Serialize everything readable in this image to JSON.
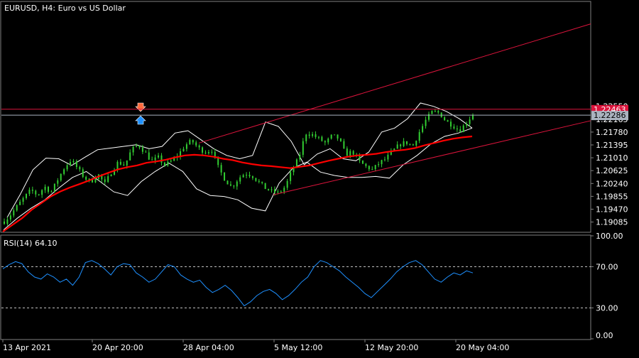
{
  "header": {
    "title": "EURUSD, H4:  Euro vs US Dollar"
  },
  "indicator": {
    "label": "RSI(14) 64.10"
  },
  "price_axis": {
    "ticks": [
      "1.22550",
      "1.22165",
      "1.21780",
      "1.21395",
      "1.21010",
      "1.20625",
      "1.20240",
      "1.19855",
      "1.19470",
      "1.19085"
    ],
    "bid_label": "1.22463",
    "ask_label": "1.22286",
    "bid_color": "#dc143c",
    "ask_color": "#aab3bf"
  },
  "rsi_axis": {
    "ticks": [
      "100.00",
      "70.00",
      "30.00",
      "0.00"
    ]
  },
  "time_axis": {
    "ticks": [
      "13 Apr 2021",
      "20 Apr 20:00",
      "28 Apr 04:00",
      "5 May 12:00",
      "12 May 20:00",
      "20 May 04:00"
    ]
  },
  "colors": {
    "background": "#000000",
    "bull": "#32cd32",
    "grid": "#808080",
    "ma": "#ff0000",
    "bands": "#ffffff",
    "trendline": "#dc143c",
    "rsi": "#1e90ff",
    "sell_arrow": "#ff6a3d",
    "buy_arrow": "#1e90ff"
  },
  "chart_data": [
    {
      "type": "candlestick",
      "symbol": "EURUSD",
      "timeframe": "H4",
      "ylim": [
        1.188,
        1.2565
      ],
      "series": [
        {
          "name": "price",
          "values": [
            1.191,
            1.1932,
            1.1958,
            1.1982,
            1.2005,
            1.1988,
            1.2015,
            1.1998,
            1.2036,
            1.2072,
            1.2095,
            1.2068,
            1.204,
            1.203,
            1.2052,
            1.2022,
            1.2058,
            1.2088,
            1.2078,
            1.2125,
            1.214,
            1.2118,
            1.209,
            1.2102,
            1.2078,
            1.2092,
            1.211,
            1.2138,
            1.2152,
            1.213,
            1.2118,
            1.2125,
            1.207,
            1.2035,
            1.2012,
            1.204,
            1.2055,
            1.2048,
            1.2028,
            1.201,
            1.2,
            1.1995,
            1.2015,
            1.2065,
            1.21,
            1.2175,
            1.217,
            1.2158,
            1.2145,
            1.2168,
            1.2158,
            1.211,
            1.212,
            1.209,
            1.2075,
            1.2065,
            1.2085,
            1.2098,
            1.212,
            1.214,
            1.2148,
            1.2135,
            1.2178,
            1.2215,
            1.224,
            1.2235,
            1.221,
            1.2198,
            1.2182,
            1.2205,
            1.2232
          ]
        },
        {
          "name": "moving average",
          "values": [
            1.188,
            1.19,
            1.192,
            1.1945,
            1.1965,
            1.1985,
            1.2,
            1.2012,
            1.2022,
            1.2033,
            1.2045,
            1.2056,
            1.2066,
            1.2073,
            1.2078,
            1.2086,
            1.209,
            1.2095,
            1.2102,
            1.2108,
            1.211,
            1.2108,
            1.2104,
            1.2098,
            1.2094,
            1.2087,
            1.2082,
            1.2078,
            1.2076,
            1.2073,
            1.207,
            1.2074,
            1.2078,
            1.2085,
            1.2092,
            1.2098,
            1.2104,
            1.2108,
            1.211,
            1.2113,
            1.2118,
            1.2122,
            1.2125,
            1.213,
            1.2138,
            1.2145,
            1.2152,
            1.2158,
            1.2162,
            1.2165
          ]
        },
        {
          "name": "upper band",
          "values": [
            1.1922,
            1.199,
            1.2065,
            1.21,
            1.2098,
            1.2078,
            1.2102,
            1.2125,
            1.213,
            1.2135,
            1.214,
            1.2128,
            1.2135,
            1.2175,
            1.2182,
            1.2155,
            1.2128,
            1.2108,
            1.2098,
            1.2108,
            1.2208,
            1.2195,
            1.215,
            1.208,
            1.2112,
            1.2128,
            1.2098,
            1.2092,
            1.2118,
            1.2178,
            1.219,
            1.2218,
            1.2265,
            1.2255,
            1.224,
            1.2218,
            1.219
          ]
        },
        {
          "name": "lower band",
          "values": [
            1.1885,
            1.192,
            1.195,
            1.1975,
            1.201,
            1.2042,
            1.206,
            1.203,
            1.1999,
            1.1988,
            1.203,
            1.206,
            1.2085,
            1.206,
            1.2008,
            1.1988,
            1.1985,
            1.1975,
            1.195,
            1.1942,
            1.2025,
            1.207,
            1.2088,
            1.2058,
            1.2048,
            1.2042,
            1.2042,
            1.2045,
            1.204,
            1.208,
            1.2108,
            1.2142,
            1.2165,
            1.2175,
            1.219
          ]
        }
      ]
    },
    {
      "type": "line",
      "name": "RSI(14)",
      "ylim": [
        0,
        100
      ],
      "levels": [
        70,
        30
      ],
      "values": [
        68,
        72,
        75,
        73,
        65,
        60,
        58,
        63,
        60,
        55,
        58,
        52,
        60,
        74,
        76,
        73,
        68,
        62,
        70,
        73,
        72,
        64,
        60,
        55,
        58,
        65,
        72,
        70,
        62,
        58,
        55,
        57,
        50,
        45,
        48,
        52,
        47,
        40,
        32,
        36,
        42,
        46,
        48,
        44,
        38,
        42,
        48,
        55,
        60,
        70,
        76,
        74,
        70,
        66,
        60,
        55,
        50,
        44,
        40,
        46,
        52,
        58,
        65,
        70,
        74,
        76,
        72,
        65,
        58,
        55,
        60,
        64,
        62,
        66,
        64
      ]
    }
  ]
}
